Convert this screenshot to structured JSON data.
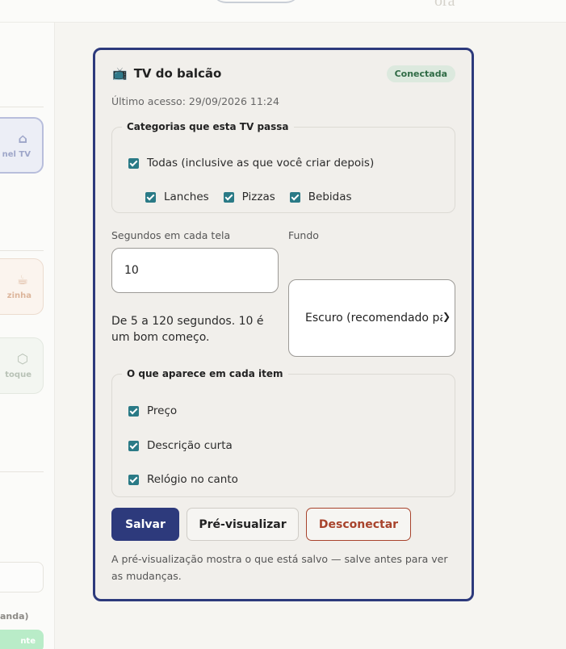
{
  "header": {
    "brand_fragment": "ora"
  },
  "rail": {
    "active_item": {
      "label": "nel TV",
      "icon": "home-icon"
    },
    "kitchen_item": {
      "label": "zinha",
      "icon": "cup-icon"
    },
    "stock_item": {
      "label": "toque",
      "icon": "box-icon"
    },
    "footer_text": "anda)",
    "footer_pill": "nte"
  },
  "card": {
    "icon": "tv-icon",
    "title": "TV do balcão",
    "status": "Conectada",
    "last_access": "Último acesso: 29/09/2026 11:24",
    "categories": {
      "legend": "Categorias que esta TV passa",
      "all_label": "Todas (inclusive as que você criar depois)",
      "items": [
        "Lanches",
        "Pizzas",
        "Bebidas"
      ]
    },
    "seconds": {
      "label": "Segundos em cada tela",
      "value": "10",
      "hint": "De 5 a 120 segundos. 10 é um bom começo."
    },
    "background": {
      "label": "Fundo",
      "selected": "Escuro (recomendado para TV)"
    },
    "item_fields": {
      "legend": "O que aparece em cada item",
      "options": [
        "Preço",
        "Descrição curta",
        "Relógio no canto"
      ]
    },
    "buttons": {
      "save": "Salvar",
      "preview": "Pré-visualizar",
      "disconnect": "Desconectar"
    },
    "footnote": "A pré-visualização mostra o que está salvo — salve antes para ver as mudanças."
  },
  "colors": {
    "primary": "#2d3a7c",
    "check": "#2a7a86",
    "danger": "#a8432c",
    "status_bg": "#dce9de",
    "status_text": "#2f6b45"
  }
}
